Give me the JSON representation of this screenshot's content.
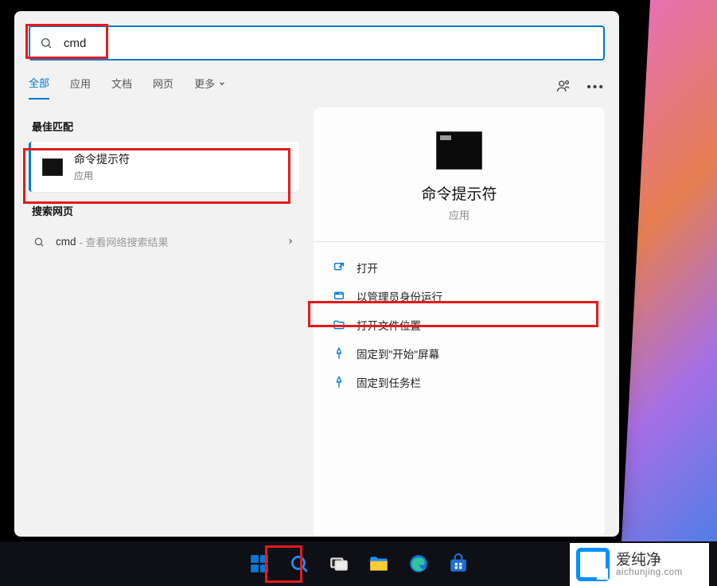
{
  "search": {
    "value": "cmd",
    "icon": "search-icon"
  },
  "tabs": {
    "items": [
      "全部",
      "应用",
      "文档",
      "网页",
      "更多"
    ],
    "active_index": 0,
    "right_icons": [
      "account-icon",
      "more-icon"
    ]
  },
  "left": {
    "best_match_label": "最佳匹配",
    "best_match": {
      "title": "命令提示符",
      "subtitle": "应用",
      "icon": "terminal-icon"
    },
    "web_label": "搜索网页",
    "web_item": {
      "query": "cmd",
      "desc": "- 查看网络搜索结果"
    }
  },
  "detail": {
    "title": "命令提示符",
    "subtitle": "应用",
    "actions": [
      {
        "icon": "open-icon",
        "label": "打开"
      },
      {
        "icon": "shield-icon",
        "label": "以管理员身份运行"
      },
      {
        "icon": "folder-icon",
        "label": "打开文件位置"
      },
      {
        "icon": "pin-icon",
        "label": "固定到\"开始\"屏幕"
      },
      {
        "icon": "pin-icon",
        "label": "固定到任务栏"
      }
    ]
  },
  "taskbar": {
    "items": [
      "start-icon",
      "search-icon",
      "task-view-icon",
      "file-explorer-icon",
      "edge-icon",
      "store-icon"
    ]
  },
  "watermark": {
    "cn": "爱纯净",
    "url": "aichunjing.com"
  },
  "highlight_color": "#e31b1b",
  "accent_color": "#0078d4"
}
